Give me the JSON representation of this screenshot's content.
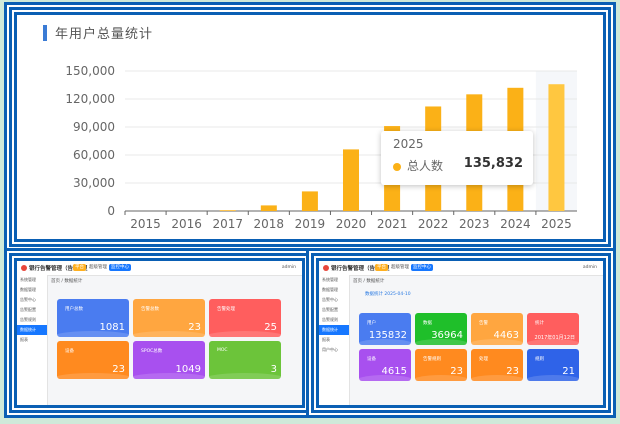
{
  "top_panel": {
    "title": "年用户总量统计",
    "tooltip": {
      "year": "2025",
      "label": "总人数",
      "value": "135,832"
    }
  },
  "chart_data": {
    "type": "bar",
    "title": "年用户总量统计",
    "categories": [
      "2015",
      "2016",
      "2017",
      "2018",
      "2019",
      "2020",
      "2021",
      "2022",
      "2023",
      "2024",
      "2025"
    ],
    "series": [
      {
        "name": "总人数",
        "values": [
          0,
          0,
          800,
          6000,
          21000,
          66000,
          91000,
          112000,
          125000,
          132000,
          135832
        ]
      }
    ],
    "ylim": [
      0,
      150000
    ],
    "yticks": [
      "0",
      "30,000",
      "60,000",
      "90,000",
      "120,000",
      "150,000"
    ],
    "grid": true,
    "bar_color": "#fbb117",
    "highlight_color": "#f5f7fa"
  },
  "left_shot": {
    "app_title": "银行告警管理（告警管理）",
    "badge_a": "平台",
    "badge_b": "超级管理",
    "badge_c": "监控中心",
    "user": "admin",
    "crumb": "首页 / 数据统计",
    "sidebar": [
      "系统管理",
      "数据管理",
      "告警中心",
      "告警配置",
      "告警规则",
      "数据统计",
      "报表"
    ],
    "cards": [
      {
        "label": "用户总数",
        "value": "1081",
        "color": "#4a7cf0"
      },
      {
        "label": "告警总数",
        "value": "23",
        "color": "#ffa640"
      },
      {
        "label": "告警处理",
        "value": "25",
        "color": "#ff5e5e"
      },
      {
        "label": "设备",
        "value": "23",
        "color": "#ff8a1f"
      },
      {
        "label": "SPOC总数",
        "value": "1049",
        "color": "#a850ef"
      },
      {
        "label": "MOC",
        "value": "3",
        "color": "#6cc43a"
      }
    ]
  },
  "right_shot": {
    "app_title": "银行告警管理（告警管理）",
    "badge_a": "平台",
    "badge_b": "超级管理",
    "badge_c": "监控中心",
    "user": "admin",
    "crumb": "首页 / 数据统计",
    "note": "数据统计 2025-04-10",
    "sidebar": [
      "系统管理",
      "数据管理",
      "告警中心",
      "告警配置",
      "告警规则",
      "数据统计",
      "报表",
      "用户中心"
    ],
    "cards": [
      {
        "label": "用户",
        "value": "135832",
        "color": "#4a7cf0"
      },
      {
        "label": "数据",
        "value": "36964",
        "color": "#1fbf2a"
      },
      {
        "label": "告警",
        "value": "4463",
        "color": "#ffa640"
      },
      {
        "label": "统计",
        "value": "2017年01月12日",
        "color": "#ff5e5e"
      },
      {
        "label": "设备",
        "value": "4615",
        "color": "#a850ef"
      },
      {
        "label": "告警规则",
        "value": "23",
        "color": "#ff8a1f"
      },
      {
        "label": "处理",
        "value": "23",
        "color": "#ff8a1f"
      },
      {
        "label": "规则",
        "value": "21",
        "color": "#2f63e8"
      }
    ]
  }
}
